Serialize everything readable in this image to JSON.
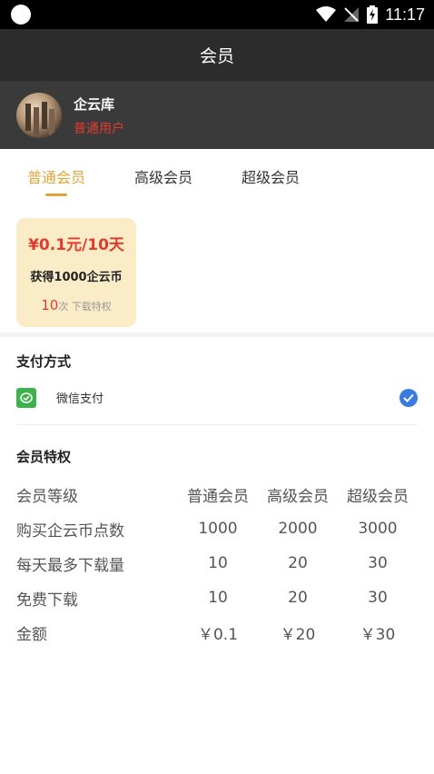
{
  "status_bar": {
    "time": "11:17"
  },
  "header": {
    "title": "会员"
  },
  "profile": {
    "name": "企云库",
    "level": "普通用户"
  },
  "tabs": [
    {
      "label": "普通会员",
      "active": true
    },
    {
      "label": "高级会员",
      "active": false
    },
    {
      "label": "超级会员",
      "active": false
    }
  ],
  "plan": {
    "price": "¥0.1元/10天",
    "coins": "获得1000企云币",
    "downloads_count": "10",
    "downloads_label": "次 下载特权"
  },
  "payment": {
    "title": "支付方式",
    "method": "微信支付"
  },
  "privileges": {
    "title": "会员特权",
    "header": [
      "会员等级",
      "普通会员",
      "高级会员",
      "超级会员"
    ],
    "rows": [
      [
        "购买企云币点数",
        "1000",
        "2000",
        "3000"
      ],
      [
        "每天最多下载量",
        "10",
        "20",
        "30"
      ],
      [
        "免费下载",
        "10",
        "20",
        "30"
      ],
      [
        "金额",
        "￥0.1",
        "￥20",
        "￥30"
      ]
    ]
  },
  "colors": {
    "accent": "#e0a43a",
    "price_red": "#e23b2e",
    "plan_card_bg": "#fbecc8",
    "wechat_green": "#3bb34a",
    "check_blue": "#3b7be0"
  }
}
